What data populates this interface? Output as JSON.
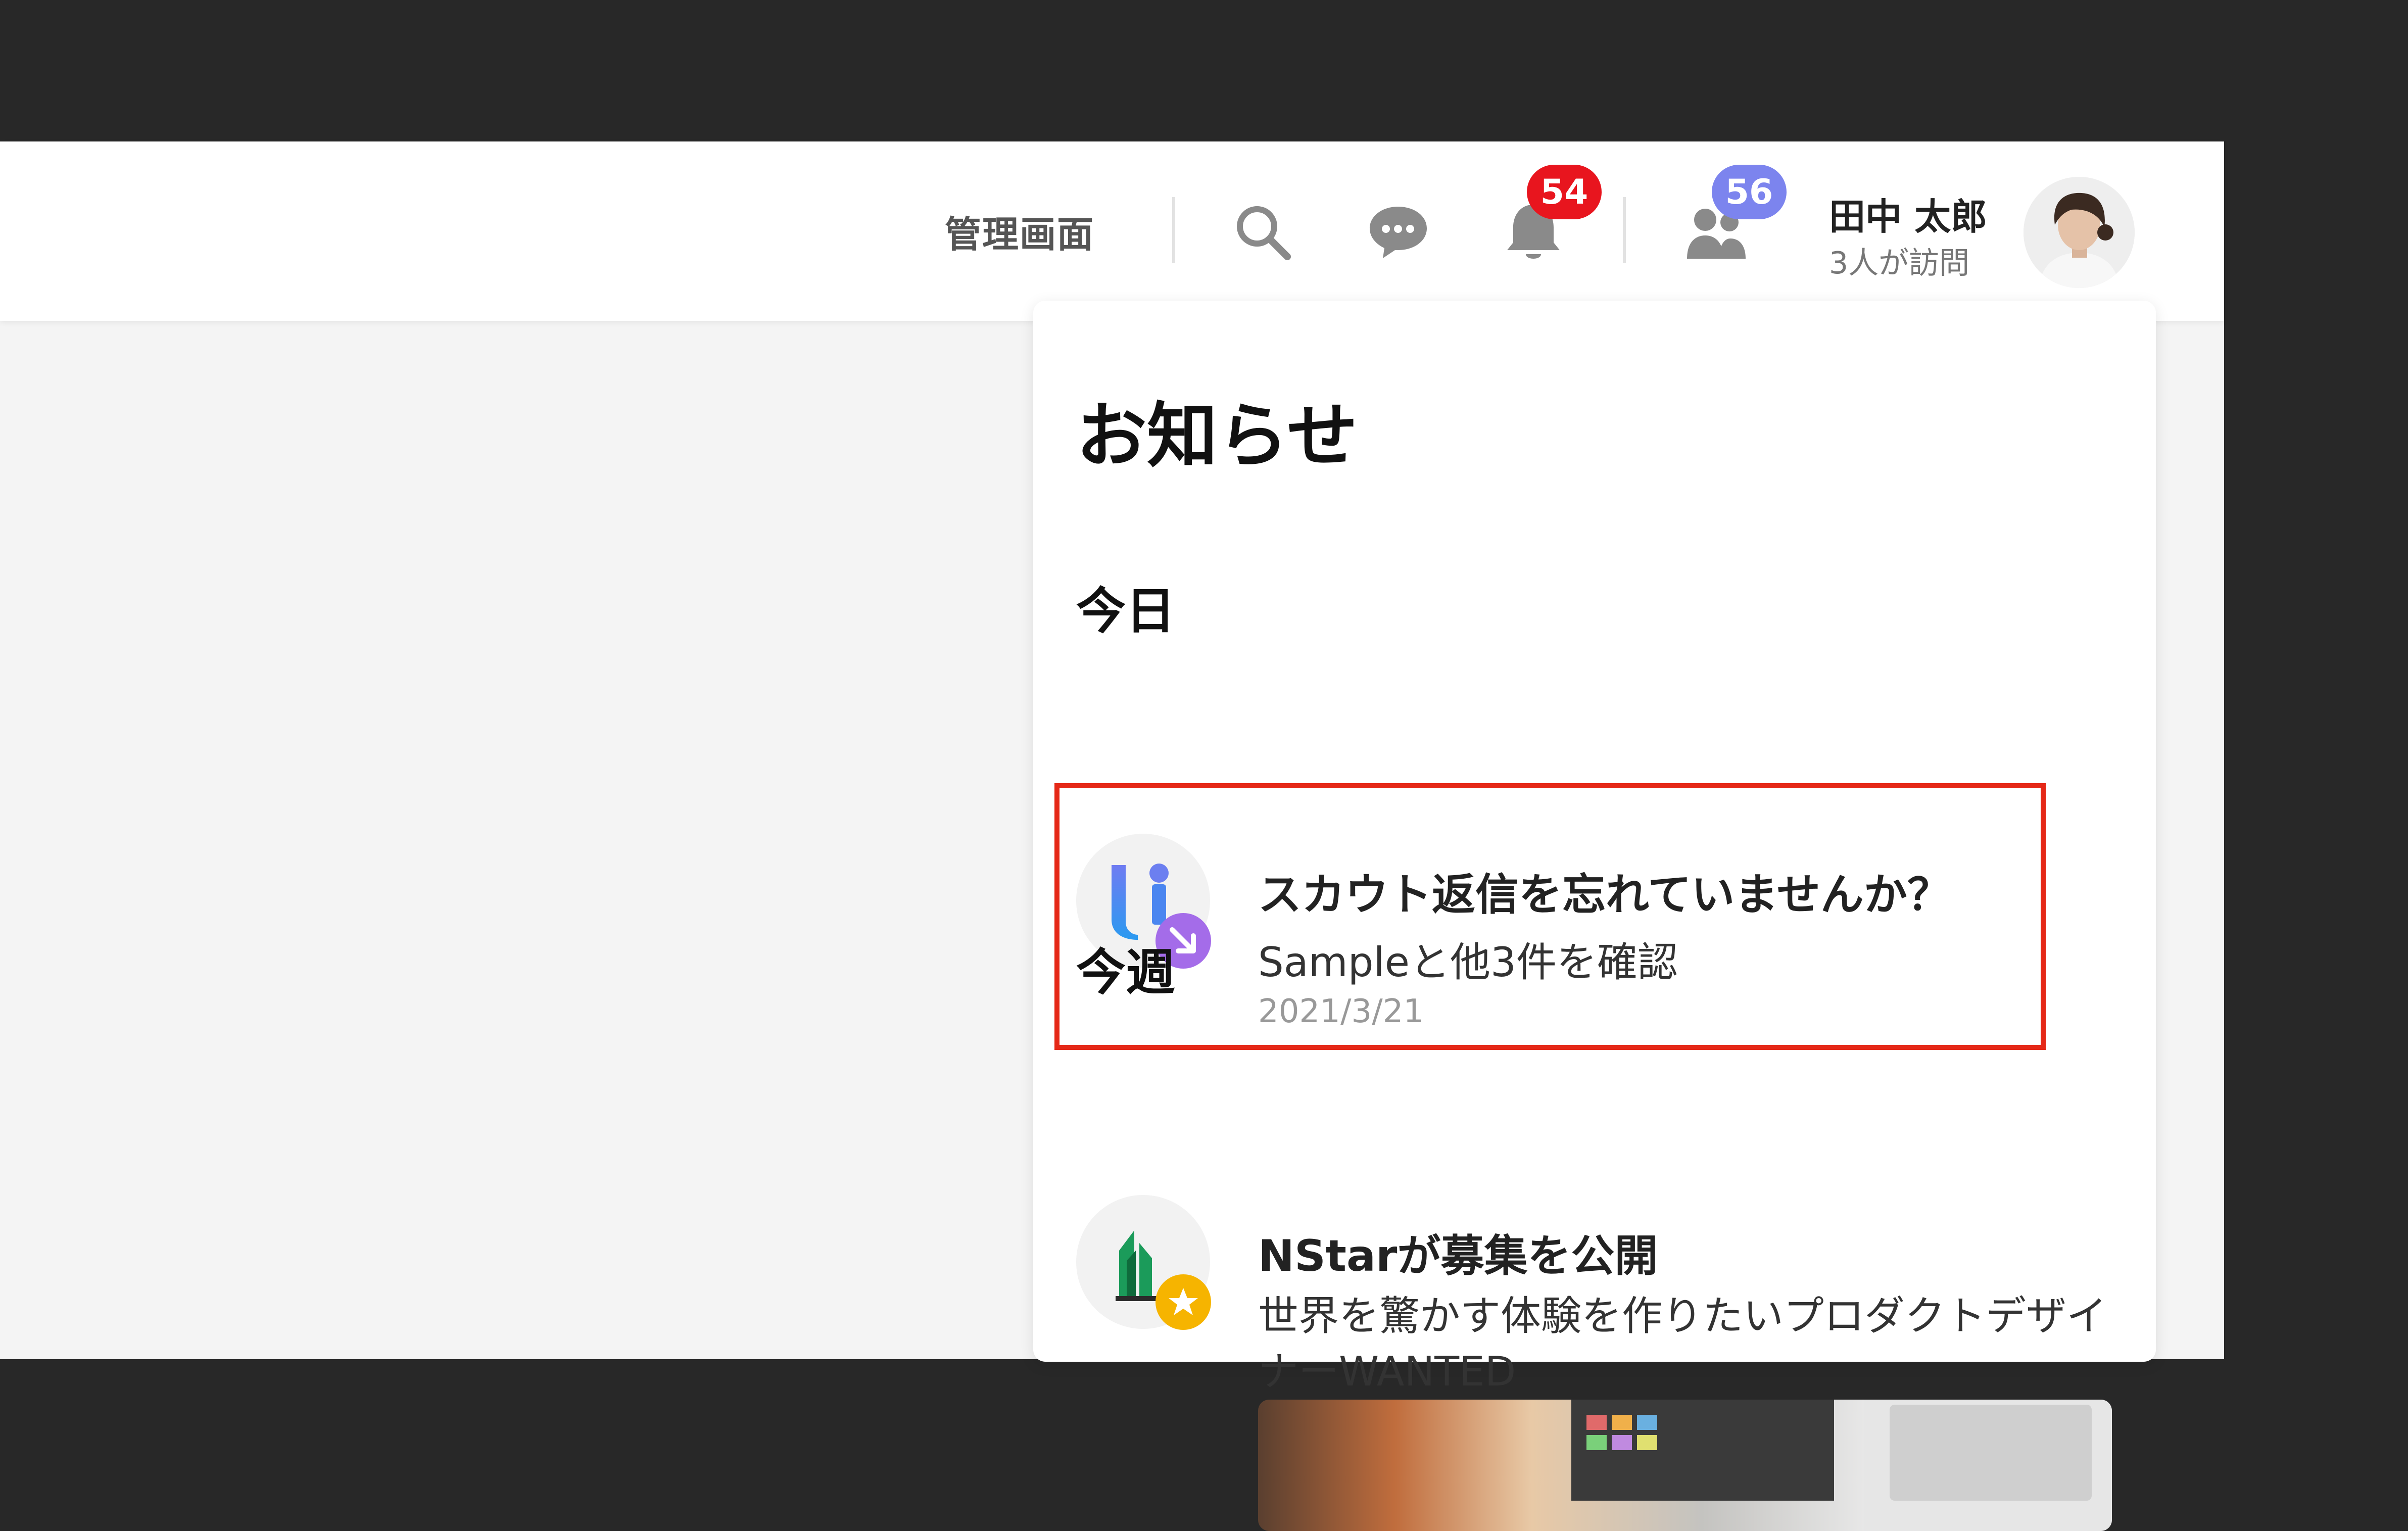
{
  "header": {
    "admin_link": "管理画面",
    "notification_badge": "54",
    "visitors_badge": "56",
    "user_name": "田中 太郎",
    "user_sub": "3人が訪問"
  },
  "icons": {
    "search": "search-icon",
    "chat": "chat-bubble-icon",
    "bell": "bell-icon",
    "people": "people-icon"
  },
  "colors": {
    "badge_red": "#e8151e",
    "badge_purple": "#7c84ee",
    "highlight": "#e52817"
  },
  "notifications_panel": {
    "title": "お知らせ",
    "sections": [
      {
        "label": "今日",
        "items": [
          {
            "title": "スカウト返信を忘れていませんか？",
            "subtitle": "Sampleと他3件を確認",
            "date": "2021/3/21"
          }
        ]
      },
      {
        "label": "今週",
        "items": [
          {
            "title": "NStarが募集を公開",
            "subtitle_line1": "世界を驚かす体験を作りたいプロダクトデザイ",
            "subtitle_line2": "ナーWANTED"
          }
        ]
      }
    ]
  }
}
